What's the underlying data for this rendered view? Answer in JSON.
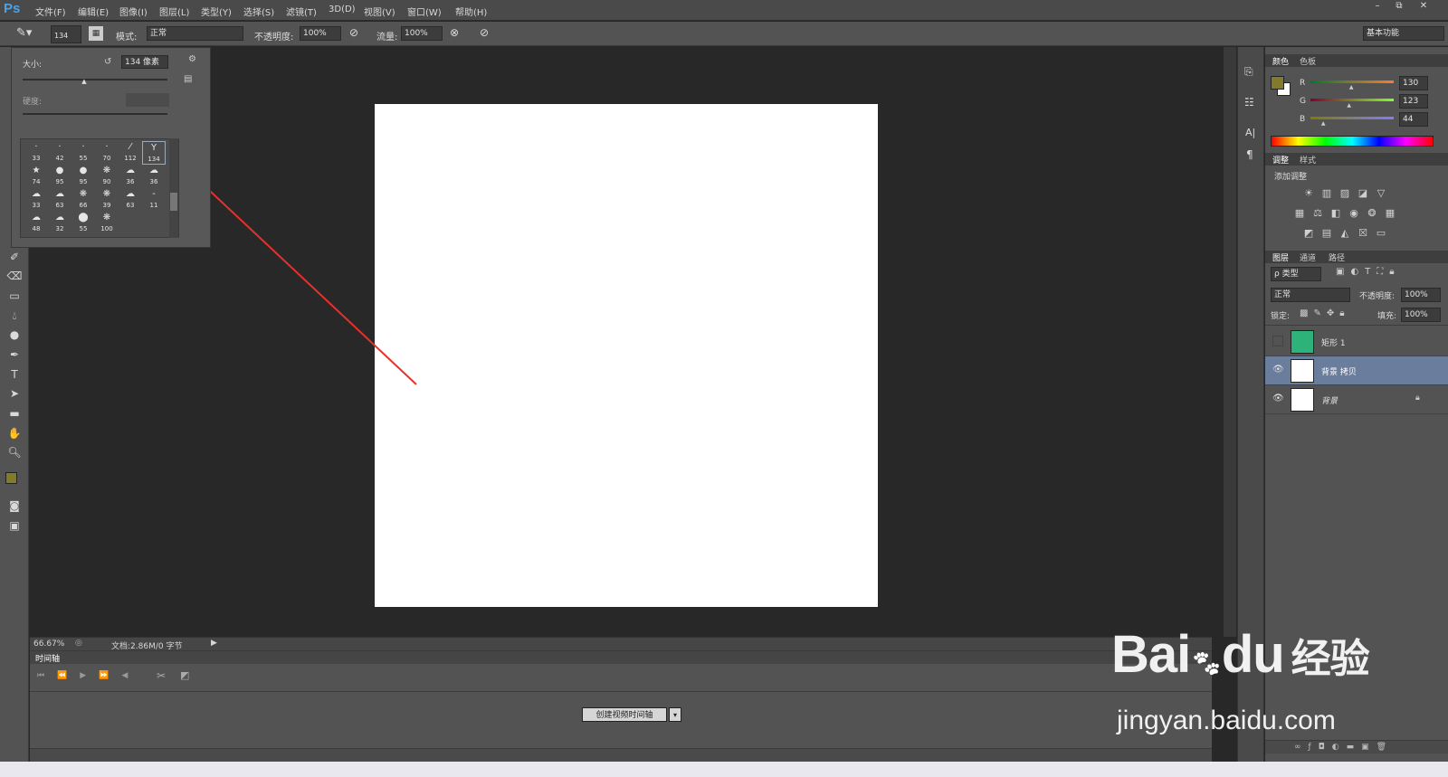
{
  "menubar": {
    "logo": "Ps",
    "items": [
      "文件(F)",
      "编辑(E)",
      "图像(I)",
      "图层(L)",
      "类型(Y)",
      "选择(S)",
      "滤镜(T)",
      "3D(D)",
      "视图(V)",
      "窗口(W)",
      "帮助(H)"
    ],
    "window_buttons": [
      "–",
      "⧉",
      "✕"
    ]
  },
  "options": {
    "brush_size": "134",
    "mode_label": "模式:",
    "mode_value": "正常",
    "opacity_label": "不透明度:",
    "opacity_value": "100%",
    "flow_label": "流量:",
    "flow_value": "100%",
    "workspace": "基本功能"
  },
  "brush_popup": {
    "size_label": "大小:",
    "size_value": "134 像素",
    "size_fraction": 0.42,
    "hardness_label": "硬度:",
    "presets": [
      {
        "glyph": "·",
        "size": "33"
      },
      {
        "glyph": "·",
        "size": "42"
      },
      {
        "glyph": "·",
        "size": "55"
      },
      {
        "glyph": "·",
        "size": "70"
      },
      {
        "glyph": "⁄",
        "size": "112"
      },
      {
        "glyph": "Y",
        "size": "134"
      },
      {
        "glyph": "★",
        "size": "74"
      },
      {
        "glyph": "●",
        "size": "95"
      },
      {
        "glyph": "●",
        "size": "95"
      },
      {
        "glyph": "❋",
        "size": "90"
      },
      {
        "glyph": "☁",
        "size": "36"
      },
      {
        "glyph": "☁",
        "size": "36"
      },
      {
        "glyph": "☁",
        "size": "33"
      },
      {
        "glyph": "☁",
        "size": "63"
      },
      {
        "glyph": "❋",
        "size": "66"
      },
      {
        "glyph": "❋",
        "size": "39"
      },
      {
        "glyph": "☁",
        "size": "63"
      },
      {
        "glyph": "‐",
        "size": "11"
      },
      {
        "glyph": "☁",
        "size": "48"
      },
      {
        "glyph": "☁",
        "size": "32"
      },
      {
        "glyph": "⬤",
        "size": "55"
      },
      {
        "glyph": "❋",
        "size": "100"
      }
    ]
  },
  "status": {
    "zoom": "66.67%",
    "doc": "文档:2.86M/0 字节"
  },
  "timeline": {
    "tab": "时间轴",
    "create_button": "创建视频时间轴"
  },
  "color_panel": {
    "tabs": [
      "颜色",
      "色板"
    ],
    "r_label": "R",
    "r": "130",
    "r_level": 130,
    "g_label": "G",
    "g": "123",
    "g_level": 123,
    "b_label": "B",
    "b": "44",
    "b_level": 44,
    "foreground": "#827b2c",
    "background": "#ffffff"
  },
  "adjust_panel": {
    "tabs": [
      "调整",
      "样式"
    ],
    "add_label": "添加调整"
  },
  "layers_panel": {
    "tabs": [
      "图层",
      "通道",
      "路径"
    ],
    "filter": "ρ 类型",
    "blend": "正常",
    "opacity_label": "不透明度:",
    "opacity": "100%",
    "lock_label": "锁定:",
    "fill_label": "填充:",
    "fill": "100%",
    "layers": [
      {
        "name": "矩形 1",
        "visible": false,
        "thumb": "#2db37a",
        "selected": false
      },
      {
        "name": "背景 拷贝",
        "visible": true,
        "thumb": "#ffffff",
        "selected": true
      },
      {
        "name": "背景",
        "visible": true,
        "thumb": "#ffffff",
        "selected": false,
        "locked": true
      }
    ]
  },
  "watermark": {
    "brand": "Bai",
    "brand_tail": "du",
    "cn": "经验",
    "url": "jingyan.baidu.com"
  },
  "colors": {
    "arrow": "#e8302c",
    "selected_layer": "#6a7d9c",
    "foreground_swatch": "#827b2c"
  }
}
